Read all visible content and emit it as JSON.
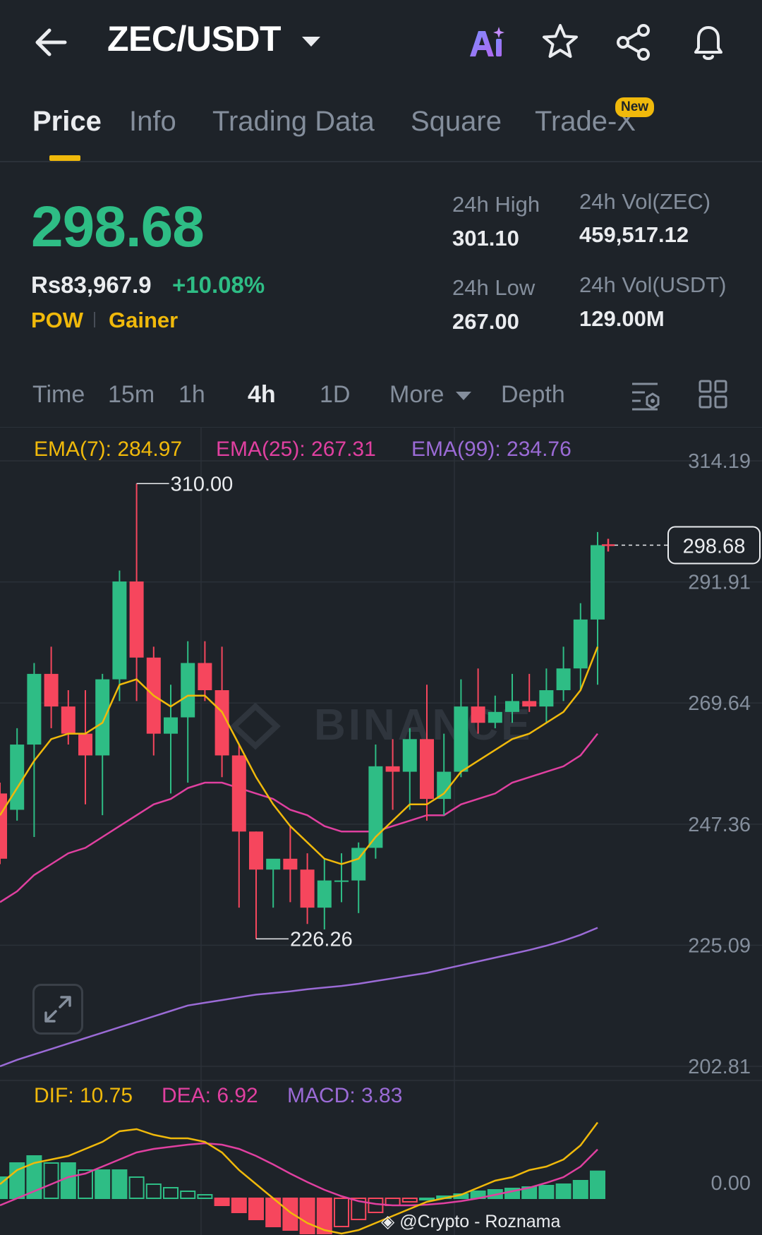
{
  "header": {
    "pair": "ZEC/USDT",
    "icons": [
      "back-arrow-icon",
      "ai-icon",
      "star-icon",
      "share-icon",
      "bell-icon"
    ]
  },
  "tabs": {
    "items": [
      "Price",
      "Info",
      "Trading Data",
      "Square",
      "Trade-X"
    ],
    "active": "Price",
    "badge": "New"
  },
  "price": {
    "last": "298.68",
    "fiat": "Rs83,967.9",
    "change": "+10.08%",
    "tag_left": "POW",
    "tag_right": "Gainer"
  },
  "stats": {
    "high_label": "24h High",
    "high_value": "301.10",
    "low_label": "24h Low",
    "low_value": "267.00",
    "vol_base_label": "24h Vol(ZEC)",
    "vol_base_value": "459,517.12",
    "vol_quote_label": "24h Vol(USDT)",
    "vol_quote_value": "129.00M"
  },
  "intervals": {
    "items": [
      "Time",
      "15m",
      "1h",
      "4h",
      "1D",
      "More",
      "Depth"
    ],
    "active": "4h"
  },
  "indicators": {
    "ema7": "EMA(7): 284.97",
    "ema25": "EMA(25): 267.31",
    "ema99": "EMA(99): 234.76",
    "dif": "DIF: 10.75",
    "dea": "DEA: 6.92",
    "macd": "MACD: 3.83"
  },
  "colors": {
    "up": "#2ebd85",
    "down": "#f6465d",
    "ema7": "#f0b90b",
    "ema25": "#e040a0",
    "ema99": "#9b6bd6",
    "accent": "#f0b90b"
  },
  "chart_data": {
    "type": "candlestick",
    "y_ticks": [
      "314.19",
      "291.91",
      "269.64",
      "247.36",
      "225.09",
      "202.81"
    ],
    "macd_zero_label": "0.00",
    "price_tag": "298.68",
    "high_marker": "310.00",
    "low_marker": "226.26",
    "watermark": "BINANCE",
    "candles": [
      {
        "o": 253,
        "h": 255,
        "l": 240,
        "c": 241
      },
      {
        "o": 250,
        "h": 265,
        "l": 248,
        "c": 262
      },
      {
        "o": 262,
        "h": 277,
        "l": 245,
        "c": 275
      },
      {
        "o": 275,
        "h": 280,
        "l": 265,
        "c": 269
      },
      {
        "o": 269,
        "h": 272,
        "l": 262,
        "c": 264
      },
      {
        "o": 264,
        "h": 272,
        "l": 251,
        "c": 260
      },
      {
        "o": 260,
        "h": 275,
        "l": 249,
        "c": 274
      },
      {
        "o": 274,
        "h": 294,
        "l": 270,
        "c": 292
      },
      {
        "o": 292,
        "h": 310,
        "l": 270,
        "c": 278
      },
      {
        "o": 278,
        "h": 280,
        "l": 260,
        "c": 264
      },
      {
        "o": 264,
        "h": 273,
        "l": 253,
        "c": 267
      },
      {
        "o": 267,
        "h": 281,
        "l": 255,
        "c": 277
      },
      {
        "o": 277,
        "h": 281,
        "l": 270,
        "c": 272
      },
      {
        "o": 272,
        "h": 280,
        "l": 256,
        "c": 260
      },
      {
        "o": 260,
        "h": 262,
        "l": 232,
        "c": 246
      },
      {
        "o": 246,
        "h": 246,
        "l": 226.26,
        "c": 239
      },
      {
        "o": 239,
        "h": 240,
        "l": 232,
        "c": 241
      },
      {
        "o": 241,
        "h": 247,
        "l": 233,
        "c": 239
      },
      {
        "o": 239,
        "h": 242,
        "l": 229,
        "c": 232
      },
      {
        "o": 232,
        "h": 241,
        "l": 228,
        "c": 237
      },
      {
        "o": 237,
        "h": 242,
        "l": 233,
        "c": 237
      },
      {
        "o": 237,
        "h": 244,
        "l": 231,
        "c": 243
      },
      {
        "o": 243,
        "h": 262,
        "l": 241,
        "c": 258
      },
      {
        "o": 258,
        "h": 263,
        "l": 250,
        "c": 257
      },
      {
        "o": 257,
        "h": 265,
        "l": 250,
        "c": 263
      },
      {
        "o": 263,
        "h": 273,
        "l": 248,
        "c": 252
      },
      {
        "o": 252,
        "h": 264,
        "l": 249,
        "c": 257
      },
      {
        "o": 257,
        "h": 274,
        "l": 256,
        "c": 269
      },
      {
        "o": 269,
        "h": 276,
        "l": 264,
        "c": 266
      },
      {
        "o": 266,
        "h": 271,
        "l": 265,
        "c": 268
      },
      {
        "o": 268,
        "h": 275,
        "l": 266,
        "c": 270
      },
      {
        "o": 270,
        "h": 275,
        "l": 268,
        "c": 269
      },
      {
        "o": 269,
        "h": 276,
        "l": 266,
        "c": 272
      },
      {
        "o": 272,
        "h": 280,
        "l": 270,
        "c": 276
      },
      {
        "o": 276,
        "h": 288,
        "l": 272,
        "c": 285
      },
      {
        "o": 285,
        "h": 301.1,
        "l": 273,
        "c": 298.68
      }
    ],
    "ema7": [
      249,
      254,
      259,
      263,
      264,
      264,
      266,
      273,
      274,
      271,
      269,
      271,
      271,
      268,
      262,
      256,
      251,
      247,
      244,
      241,
      240,
      241,
      245,
      248,
      251,
      251,
      253,
      257,
      259,
      261,
      263,
      264,
      266,
      268,
      272,
      280
    ],
    "ema25": [
      233,
      235,
      238,
      240,
      242,
      243,
      245,
      247,
      249,
      251,
      252,
      254,
      255,
      255,
      254,
      253,
      252,
      250,
      249,
      247,
      246,
      246,
      246,
      247,
      248,
      249,
      249,
      251,
      252,
      253,
      255,
      256,
      257,
      258,
      260,
      264
    ],
    "ema99": [
      202.81,
      204,
      205,
      206,
      207,
      208,
      209,
      210,
      211,
      212,
      213,
      214,
      214.5,
      215,
      215.5,
      216,
      216.3,
      216.6,
      217,
      217.3,
      217.6,
      218,
      218.5,
      219,
      219.5,
      220,
      220.7,
      221.4,
      222.1,
      222.8,
      223.5,
      224.2,
      225,
      225.9,
      227,
      228.3
    ],
    "macd_hist": [
      3,
      5,
      6,
      5,
      5,
      4,
      4,
      4,
      3,
      2,
      1.5,
      1,
      0.5,
      -1,
      -2,
      -3,
      -4,
      -4.5,
      -5,
      -5,
      -4,
      -3,
      -2,
      -1,
      -0.5,
      0,
      0.3,
      0.6,
      1,
      1.2,
      1.4,
      1.6,
      1.8,
      2,
      2.5,
      3.83
    ],
    "dif": [
      2,
      4,
      5,
      5.5,
      6,
      7,
      8,
      9.5,
      9.8,
      9,
      8.5,
      8.5,
      8,
      6.5,
      4,
      2,
      0,
      -2,
      -3.5,
      -4.5,
      -5,
      -4.5,
      -3.5,
      -2.5,
      -1.5,
      -0.5,
      0,
      0.5,
      1.5,
      2.5,
      3,
      4,
      4.5,
      5.5,
      7.5,
      10.75
    ],
    "dea": [
      -1,
      0,
      1,
      2,
      3,
      3.5,
      4.5,
      5.5,
      6.5,
      7,
      7.3,
      7.6,
      7.8,
      7.6,
      7,
      6,
      4.8,
      3.5,
      2.3,
      1.2,
      0.3,
      -0.4,
      -0.8,
      -1,
      -1,
      -0.9,
      -0.7,
      -0.4,
      0,
      0.5,
      1,
      1.5,
      2.2,
      3,
      4.5,
      6.92
    ]
  }
}
